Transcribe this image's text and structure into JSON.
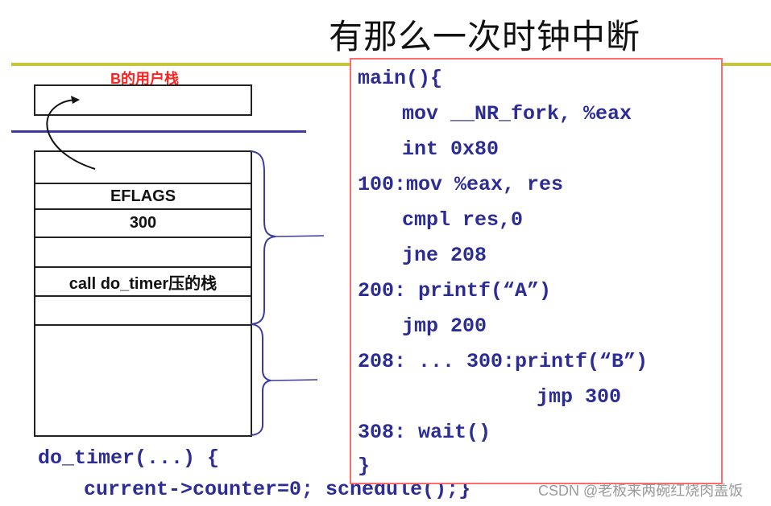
{
  "title": "有那么一次时钟中断",
  "user_stack": {
    "label": "B的用户栈"
  },
  "kernel_stack": {
    "cells": [
      {
        "text": ""
      },
      {
        "text": "EFLAGS"
      },
      {
        "text": "300"
      },
      {
        "text": ""
      },
      {
        "text": "call do_timer压的栈"
      },
      {
        "text": ""
      },
      {
        "text": ""
      }
    ]
  },
  "code": {
    "lines": [
      {
        "indent": 0,
        "text": "main(){"
      },
      {
        "indent": 1,
        "text": "mov __NR_fork, %eax"
      },
      {
        "indent": 1,
        "text": "int 0x80"
      },
      {
        "indent": 0,
        "text": "100:mov %eax, res"
      },
      {
        "indent": 1,
        "text": "cmpl res,0"
      },
      {
        "indent": 1,
        "text": "jne 208"
      },
      {
        "indent": 0,
        "text": "200: printf(“A”)"
      },
      {
        "indent": 1,
        "text": "jmp 200"
      },
      {
        "indent": 0,
        "text": "208: ... 300:printf(“B”)"
      },
      {
        "indent": 2,
        "text": "jmp 300"
      },
      {
        "indent": 0,
        "text": "308: wait()"
      },
      {
        "indent": 0,
        "text": "}"
      }
    ]
  },
  "do_timer": {
    "line1": "do_timer(...) {",
    "line2": "current->counter=0; schedule();}"
  },
  "watermark": "CSDN @老板来两碗红烧肉盖饭",
  "colors": {
    "title": "#111111",
    "user_label": "#ff2020",
    "code_text": "#2c2c96",
    "code_border": "#ff6a6a",
    "olive_line": "#c8c43c",
    "blue_line": "#3a3aa0",
    "brace": "#3a3aa0"
  }
}
